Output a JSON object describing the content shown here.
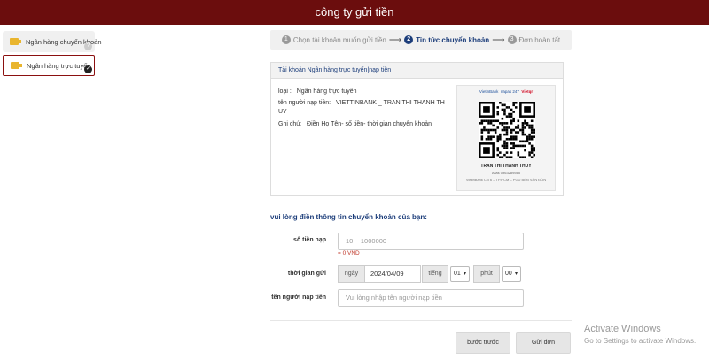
{
  "header": {
    "title": "công ty gửi tiền"
  },
  "sidebar": {
    "items": [
      {
        "label": "Ngân hàng chuyển khoản",
        "icon": "wallet-icon",
        "badge": "?"
      },
      {
        "label": "Ngân hàng trực tuyến",
        "icon": "wallet-icon",
        "badge": "✓"
      }
    ]
  },
  "steps": [
    {
      "num": "1",
      "label": "Chọn tài khoản muốn gửi tiền"
    },
    {
      "num": "2",
      "label": "Tin tức chuyển khoản"
    },
    {
      "num": "3",
      "label": "Đơn hoàn tất"
    }
  ],
  "card": {
    "title": "Tài khoản Ngân hàng trực tuyến|nạp tiền",
    "type_label": "loại :",
    "type_value": "Ngân hàng trực tuyến",
    "receiver_label": "tên người nạp tiền:",
    "receiver_value": "VIETTINBANK _ TRAN THI THANH TH",
    "receiver_value_2": "UY",
    "note_label": "Ghi chú:",
    "note_value": "Điền Họ Tên- số tiền- thời gian chuyển khoản",
    "qr": {
      "bank_1": "VietinBank",
      "bank_2": "napas 247",
      "bank_3": "Vietqr",
      "name": "TRAN THI THANH THUY",
      "account": "Alias 0963289565",
      "branch": "VietinBank CN 6 – TP.HCM – PGD BẾN VÂN ĐỒN"
    }
  },
  "form": {
    "section_title": "vui lòng điền thông tin chuyển khoản của bạn:",
    "amount_label": "số tiền nạp",
    "amount_placeholder": "10 ~ 1000000",
    "amount_hint": "= 0 VND",
    "time_label": "thời gian gửi",
    "day_addon": "ngày",
    "date_value": "2024/04/09",
    "hour_addon": "tiếng",
    "hour_value": "01",
    "minute_addon": "phút",
    "minute_value": "00",
    "name_label": "tên người nạp tiền",
    "name_placeholder": "Vui lòng nhập tên người nạp tiền"
  },
  "buttons": {
    "back": "bước trước",
    "submit": "Gửi đơn"
  },
  "watermark": {
    "line1": "Activate Windows",
    "line2": "Go to Settings to activate Windows."
  },
  "colors": {
    "header_bg": "#6b0d0d",
    "accent": "#1c3d7a",
    "hint": "#c0392b"
  }
}
